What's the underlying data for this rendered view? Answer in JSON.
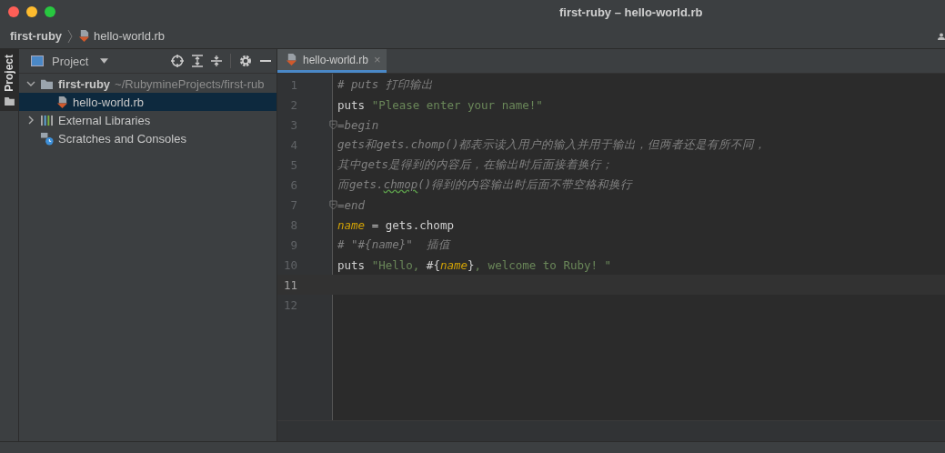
{
  "window": {
    "title": "first-ruby – hello-world.rb"
  },
  "breadcrumb": [
    {
      "label": "first-ruby",
      "kind": "project"
    },
    {
      "label": "hello-world.rb",
      "kind": "file"
    }
  ],
  "side_strip": {
    "label": "Project"
  },
  "project_panel": {
    "title": "Project",
    "tree": [
      {
        "label": "first-ruby",
        "path": "~/RubymineProjects/first-rub",
        "kind": "folder",
        "expanded": true,
        "selected": false,
        "children": [
          {
            "label": "hello-world.rb",
            "kind": "ruby",
            "selected": true
          }
        ]
      },
      {
        "label": "External Libraries",
        "kind": "libraries",
        "expanded": false,
        "selected": false
      },
      {
        "label": "Scratches and Consoles",
        "kind": "scratches",
        "selected": false
      }
    ]
  },
  "editor": {
    "tabs": [
      {
        "label": "hello-world.rb",
        "close": "×",
        "selected": true
      }
    ],
    "lines": [
      {
        "number": "1",
        "current": false,
        "fold": false,
        "tokens": [
          {
            "kind": "comment",
            "text": "# puts 打印输出"
          }
        ]
      },
      {
        "number": "2",
        "current": false,
        "fold": false,
        "tokens": [
          {
            "kind": "plain",
            "text": "puts "
          },
          {
            "kind": "string",
            "text": "\"Please enter your name!\""
          }
        ]
      },
      {
        "number": "3",
        "current": false,
        "fold": true,
        "tokens": [
          {
            "kind": "doc",
            "text": "=begin"
          }
        ]
      },
      {
        "number": "4",
        "current": false,
        "fold": false,
        "tokens": [
          {
            "kind": "doc",
            "text": "gets和gets.chomp()都表示读入用户的输入并用于输出，但两者还是有所不同，"
          }
        ]
      },
      {
        "number": "5",
        "current": false,
        "fold": false,
        "tokens": [
          {
            "kind": "doc",
            "text": "其中gets是得到的内容后，在输出时后面接着换行；"
          }
        ]
      },
      {
        "number": "6",
        "current": false,
        "fold": false,
        "tokens": [
          {
            "kind": "doc",
            "text": "而gets."
          },
          {
            "kind": "typo",
            "text": "chmop"
          },
          {
            "kind": "doc",
            "text": "()得到的内容输出时后面不带空格和换行"
          }
        ]
      },
      {
        "number": "7",
        "current": false,
        "fold": true,
        "tokens": [
          {
            "kind": "doc",
            "text": "=end"
          }
        ]
      },
      {
        "number": "8",
        "current": false,
        "fold": false,
        "tokens": [
          {
            "kind": "var",
            "text": "name"
          },
          {
            "kind": "plain",
            "text": " = gets.chomp"
          }
        ]
      },
      {
        "number": "9",
        "current": false,
        "fold": false,
        "tokens": [
          {
            "kind": "comment",
            "text": "# \"#{name}\"  插值"
          }
        ]
      },
      {
        "number": "10",
        "current": false,
        "fold": false,
        "tokens": [
          {
            "kind": "plain",
            "text": "puts "
          },
          {
            "kind": "string",
            "text": "\"Hello, "
          },
          {
            "kind": "plain",
            "text": "#{"
          },
          {
            "kind": "var",
            "text": "name"
          },
          {
            "kind": "plain",
            "text": "}"
          },
          {
            "kind": "string",
            "text": ", welcome to Ruby! \""
          }
        ]
      },
      {
        "number": "11",
        "current": true,
        "fold": false
      },
      {
        "number": "12",
        "current": false,
        "fold": false
      }
    ]
  }
}
